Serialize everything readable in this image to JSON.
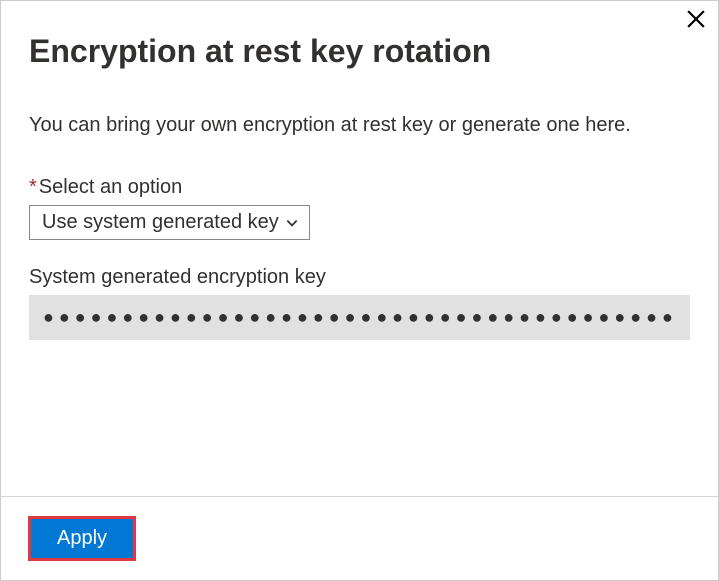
{
  "dialog": {
    "title": "Encryption at rest key rotation",
    "description": "You can bring your own encryption at rest key or generate one here."
  },
  "form": {
    "option_label": "Select an option",
    "option_selected": "Use system generated key",
    "key_label": "System generated encryption key",
    "key_masked": "●●●●●●●●●●●●●●●●●●●●●●●●●●●●●●●●●●●●●●●●"
  },
  "footer": {
    "apply_label": "Apply"
  }
}
